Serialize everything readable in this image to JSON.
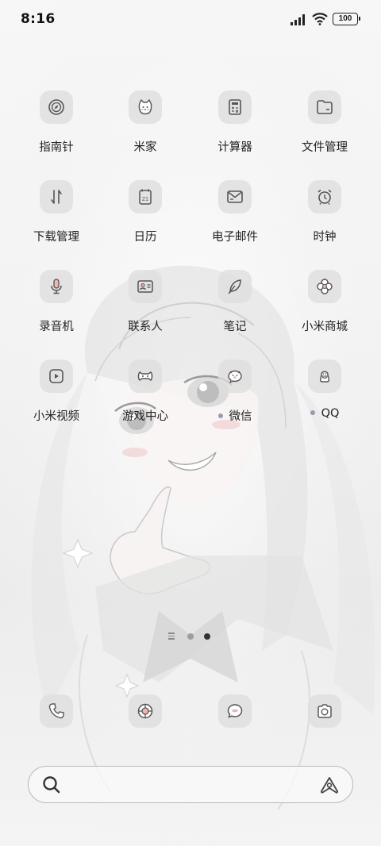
{
  "status_bar": {
    "time": "8:16",
    "battery": "100"
  },
  "apps": [
    {
      "label": "指南针",
      "icon": "compass-icon"
    },
    {
      "label": "米家",
      "icon": "mijia-cat-icon"
    },
    {
      "label": "计算器",
      "icon": "calculator-icon"
    },
    {
      "label": "文件管理",
      "icon": "folder-icon"
    },
    {
      "label": "下载管理",
      "icon": "download-arrows-icon"
    },
    {
      "label": "日历",
      "icon": "calendar-icon",
      "date": "21"
    },
    {
      "label": "电子邮件",
      "icon": "mail-icon"
    },
    {
      "label": "时钟",
      "icon": "alarm-clock-icon"
    },
    {
      "label": "录音机",
      "icon": "microphone-icon"
    },
    {
      "label": "联系人",
      "icon": "contact-card-icon"
    },
    {
      "label": "笔记",
      "icon": "feather-icon"
    },
    {
      "label": "小米商城",
      "icon": "mi-store-icon"
    },
    {
      "label": "小米视频",
      "icon": "play-icon"
    },
    {
      "label": "游戏中心",
      "icon": "gamepad-icon"
    },
    {
      "label": "微信",
      "icon": "wechat-icon",
      "new_dot": true
    },
    {
      "label": "QQ",
      "icon": "qq-penguin-icon",
      "new_dot": true
    }
  ],
  "page_indicator": {
    "pages": 2,
    "current": 2
  },
  "dock": [
    {
      "icon": "phone-icon"
    },
    {
      "icon": "browser-icon"
    },
    {
      "icon": "message-icon"
    },
    {
      "icon": "camera-icon"
    }
  ],
  "search": {
    "icon": "search-icon",
    "assistant_icon": "ai-assistant-icon"
  },
  "colors": {
    "icon_bg": "#dedede",
    "icon_line": "#555555",
    "accent_pink": "#f2b3b3"
  }
}
